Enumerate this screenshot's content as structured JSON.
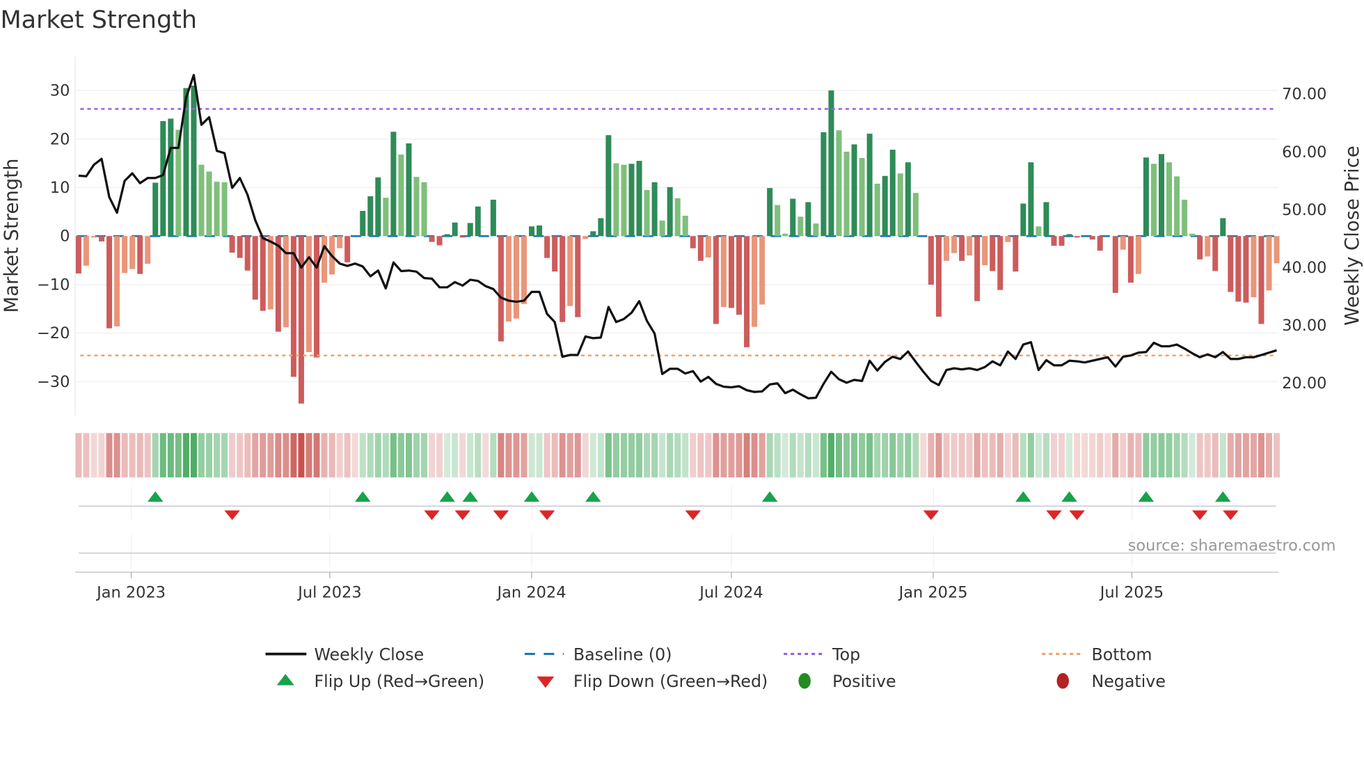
{
  "chart_data": {
    "type": "bar",
    "title": "Market Strength",
    "ylabel": "Market Strength",
    "y2label": "Weekly Close Price",
    "source": "source: sharemaestro.com",
    "start_date": "2022-11-14",
    "frequency": "weekly",
    "ylim": [
      -37,
      37
    ],
    "y2lim": [
      14.4,
      76.5
    ],
    "yticks": [
      30,
      20,
      10,
      0,
      -10,
      -20,
      -30
    ],
    "ytick_labels": [
      "30",
      "20",
      "10",
      "0",
      "−10",
      "−20",
      "−30"
    ],
    "y2ticks": [
      70,
      60,
      50,
      40,
      30,
      20
    ],
    "y2tick_labels": [
      "70.00",
      "60.00",
      "50.00",
      "40.00",
      "30.00",
      "20.00"
    ],
    "xticks": [
      "2023-01-01",
      "2023-07-01",
      "2024-01-01",
      "2024-07-01",
      "2025-01-01",
      "2025-07-01"
    ],
    "xtick_labels": [
      "Jan 2023",
      "Jul 2023",
      "Jan 2024",
      "Jul 2024",
      "Jan 2025",
      "Jul 2025"
    ],
    "top_level": 26.2,
    "bottom_level": -24.6,
    "baseline": 0,
    "grid": true,
    "legend_position": "bottom",
    "colors": {
      "pos_strong": "#2e8b57",
      "pos_weak": "#7fbf7b",
      "neg_strong": "#cd5c5c",
      "neg_weak": "#e9967a",
      "close": "#111111",
      "baseline": "#1f77b4",
      "top": "#9b5de5",
      "bottom": "#f4a261",
      "flip_up": "#16a34a",
      "flip_down": "#dc2626",
      "positive": "#228b22",
      "negative": "#b22222"
    },
    "strength": [
      -7.7,
      -6.1,
      -0.3,
      -1.1,
      -19,
      -18.6,
      -7.6,
      -6.8,
      -7.8,
      -5.7,
      11,
      23.7,
      24.2,
      21.9,
      30.5,
      31,
      14.7,
      13.3,
      11.2,
      11.1,
      -3.4,
      -4.5,
      -7.1,
      -13.1,
      -15.4,
      -15.1,
      -19.7,
      -18.8,
      -29,
      -34.5,
      -23.9,
      -25,
      -9.6,
      -7.9,
      -2.5,
      -5.4,
      0,
      5.2,
      8.2,
      12.1,
      7.9,
      21.5,
      16.8,
      19.1,
      12.2,
      11.1,
      -1.2,
      -1.9,
      0.4,
      2.8,
      -0.3,
      2.7,
      6.1,
      0,
      7.5,
      -21.7,
      -17.6,
      -17,
      -14,
      2,
      2.2,
      -4.5,
      -7.3,
      -17.7,
      -14.4,
      -16.7,
      -0.6,
      1,
      3.7,
      20.8,
      15,
      14.7,
      14.9,
      15.5,
      9.5,
      11.1,
      3.2,
      10.1,
      7.8,
      4.2,
      -2.5,
      -5.1,
      -4.4,
      -18.1,
      -14.6,
      -14.8,
      -16.2,
      -22.9,
      -18.7,
      -14.1,
      9.9,
      6.4,
      0.5,
      7.7,
      4,
      7,
      2.6,
      21.4,
      30,
      21.8,
      17.4,
      18.9,
      16.1,
      21.1,
      10.8,
      12.4,
      17.8,
      12.9,
      15.2,
      8.9,
      0,
      -10,
      -16.6,
      -5.1,
      -3.5,
      -5.1,
      -4,
      -13.4,
      -6,
      -7.2,
      -11.1,
      -1.2,
      -7.3,
      6.7,
      15.2,
      2,
      7,
      -2,
      -2,
      0.4,
      -0.3,
      0,
      -0.7,
      -3,
      0,
      -11.7,
      -2.8,
      -9.6,
      -7.8,
      16.2,
      14.9,
      16.9,
      15.2,
      12.3,
      7.5,
      0.5,
      -4.8,
      -4.2,
      -7.2,
      3.7,
      -11.5,
      -13.5,
      -13.7,
      -12.6,
      -18.1,
      -11.2,
      -5.6
    ],
    "close": [
      55.9,
      55.8,
      57.8,
      58.8,
      52.2,
      49.5,
      55.0,
      56.3,
      54.6,
      55.5,
      55.5,
      56.0,
      60.7,
      60.7,
      69.4,
      73.3,
      64.7,
      66.0,
      60.2,
      59.8,
      53.8,
      55.5,
      52.6,
      48.2,
      45.1,
      44.5,
      43.8,
      42.5,
      42.5,
      40.0,
      41.8,
      40.0,
      43.7,
      42.0,
      40.7,
      40.3,
      40.7,
      40.2,
      38.5,
      39.5,
      36.4,
      40.9,
      39.4,
      39.5,
      39.3,
      38.2,
      38.1,
      36.6,
      36.6,
      37.5,
      36.9,
      37.9,
      37.7,
      36.8,
      36.3,
      34.8,
      34.3,
      34.1,
      34.3,
      35.8,
      35.8,
      32.0,
      30.6,
      24.6,
      24.9,
      24.9,
      28.1,
      27.8,
      27.9,
      33.2,
      30.6,
      31.1,
      32.2,
      34.2,
      30.8,
      28.6,
      21.6,
      22.5,
      22.5,
      21.7,
      22.1,
      20.3,
      21.1,
      19.9,
      19.4,
      19.3,
      19.5,
      18.8,
      18.5,
      18.6,
      19.8,
      20.0,
      18.3,
      18.9,
      18.1,
      17.4,
      17.5,
      19.9,
      22.0,
      20.7,
      20.1,
      20.6,
      20.4,
      23.9,
      22.2,
      23.7,
      24.6,
      24.2,
      25.5,
      23.7,
      22.0,
      20.4,
      19.7,
      22.3,
      22.6,
      22.4,
      22.6,
      22.3,
      22.8,
      23.8,
      23.1,
      25.5,
      24.2,
      26.7,
      27.1,
      22.3,
      24.0,
      23.1,
      23.1,
      23.9,
      23.8,
      23.6,
      23.9,
      24.2,
      24.5,
      22.9,
      24.6,
      24.8,
      25.3,
      25.4,
      27.0,
      26.4,
      26.4,
      26.7,
      26.0,
      25.2,
      24.5,
      25.0,
      24.5,
      25.4,
      24.2,
      24.2,
      24.5,
      24.5,
      24.9,
      25.3,
      25.7
    ],
    "legend": {
      "close": "Weekly Close",
      "baseline": "Baseline (0)",
      "top": "Top",
      "bottom": "Bottom",
      "flip_up": "Flip Up (Red→Green)",
      "flip_down": "Flip Down (Green→Red)",
      "positive": "Positive",
      "negative": "Negative"
    }
  }
}
